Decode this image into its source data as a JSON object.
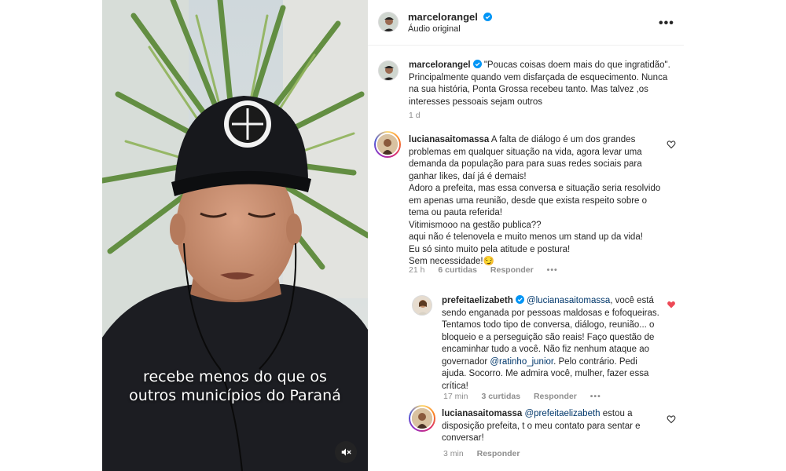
{
  "video": {
    "caption_line1": "recebe menos do que os",
    "caption_line2": "outros municípios do Paraná",
    "mute_icon": "speaker-muted-icon"
  },
  "header": {
    "username": "marcelorangel",
    "audio": "Áudio original",
    "more": "•••"
  },
  "caption_post": {
    "username": "marcelorangel",
    "text": " \"Poucas coisas doem mais do que ingratidão\". Principalmente quando vem disfarçada de esquecimento. Nunca na sua história, Ponta Grossa recebeu tanto. Mas talvez ,os interesses pessoais sejam outros",
    "time": "1 d"
  },
  "comments": [
    {
      "username": "lucianasaitomassa",
      "lines": [
        " A falta de diálogo é um dos grandes problemas em qualquer situação na vida, agora levar uma demanda da população para para suas redes sociais para ganhar likes, daí já é demais!",
        "Adoro a prefeita, mas essa conversa e situação seria resolvido em apenas uma reunião, desde que exista respeito sobre o tema ou pauta referida!",
        "Vitimismooo na gestão publica??",
        "aqui não é telenovela e muito menos um stand up da vida!",
        "Eu só sinto muito pela atitude e postura!",
        "Sem necessidade!😏"
      ],
      "time": "21 h",
      "likes": "6 curtidas",
      "reply": "Responder",
      "more": "•••"
    },
    {
      "username": "prefeitaelizabeth",
      "mention": "@lucianasaitomassa",
      "text1": ", você está sendo enganada por pessoas maldosas e fofoqueiras. Tentamos todo tipo de conversa, diálogo, reunião... o bloqueio e a perseguição são reais! Faço questão de encaminhar tudo a você. Não fiz nenhum ataque ao governador ",
      "mention2": "@ratinho_junior",
      "text2": ". Pelo contrário. Pedi ajuda. Socorro. Me admira você, mulher, fazer essa crítica!",
      "time": "17 min",
      "likes": "3 curtidas",
      "reply": "Responder",
      "more": "•••"
    },
    {
      "username": "lucianasaitomassa",
      "mention": "@prefeitaelizabeth",
      "text": " estou a disposição prefeita, t o meu contato para sentar e conversar!",
      "time": "3 min",
      "reply": "Responder"
    }
  ],
  "colors": {
    "link": "#00376b",
    "verified": "#0095f6",
    "liked": "#ed4956",
    "meta": "#8e8e8e"
  }
}
